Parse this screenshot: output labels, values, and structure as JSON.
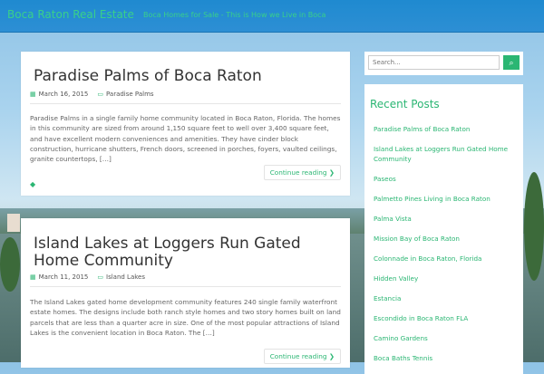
{
  "header": {
    "title": "Boca Raton Real Estate",
    "tagline": "Boca Homes for Sale - This is How we Live in Boca"
  },
  "posts": [
    {
      "title": "Paradise Palms of Boca Raton",
      "date": "March 16, 2015",
      "category": "Paradise Palms",
      "excerpt": "Paradise Palms in a single family home community located in Boca Raton, Florida. The homes in this community are sized from around 1,150 square feet to well over 3,400 square feet, and have excellent modern conveniences and amenities. They have cinder block construction, hurricane shutters, French doors, screened in porches, foyers, vaulted ceilings, granite countertops, […]",
      "more": "Continue reading"
    },
    {
      "title": "Island Lakes at Loggers Run Gated Home Community",
      "date": "March 11, 2015",
      "category": "Island Lakes",
      "excerpt": "The Island Lakes gated home development community features 240 single family waterfront estate homes. The designs include both ranch style homes and two story homes built on land parcels that are less than a quarter acre in size. One of the most popular attractions of Island Lakes is the convenient location in Boca Raton. The […]",
      "more": "Continue reading"
    }
  ],
  "sidebar": {
    "search_placeholder": "Search...",
    "recent_title": "Recent Posts",
    "recent_posts": [
      "Paradise Palms of Boca Raton",
      "Island Lakes at Loggers Run Gated Home Community",
      "Paseos",
      "Palmetto Pines Living in Boca Raton",
      "Palma Vista",
      "Mission Bay of Boca Raton",
      "Colonnade in Boca Raton, Florida",
      "Hidden Valley",
      "Estancia",
      "Escondido in Boca Raton FLA",
      "Camino Gardens",
      "Boca Baths Tennis"
    ]
  },
  "icons": {
    "calendar": "calendar-icon",
    "folder": "folder-icon",
    "tag": "tag-icon",
    "search": "search-icon",
    "chevron": "chevron-right-icon"
  },
  "colors": {
    "accent": "#2bb673",
    "header_bg": "#2d8fd4"
  }
}
